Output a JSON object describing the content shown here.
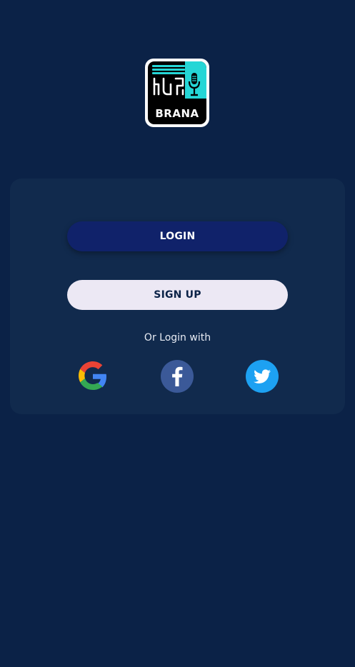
{
  "logo": {
    "wordmark": "BRANA",
    "icon": "microphone-icon"
  },
  "auth": {
    "login_label": "LOGIN",
    "signup_label": "SIGN UP",
    "alt_login_text": "Or Login with"
  },
  "social": [
    {
      "name": "Google",
      "icon": "google-icon",
      "color": "#4285F4"
    },
    {
      "name": "Facebook",
      "icon": "facebook-icon",
      "color": "#3b5998"
    },
    {
      "name": "Twitter",
      "icon": "twitter-icon",
      "color": "#1da1f2"
    }
  ],
  "colors": {
    "background": "#0b2247",
    "card": "#112a4d",
    "login_button": "#10226a",
    "signup_button": "#ece8f4",
    "logo_accent": "#25d6d6"
  }
}
